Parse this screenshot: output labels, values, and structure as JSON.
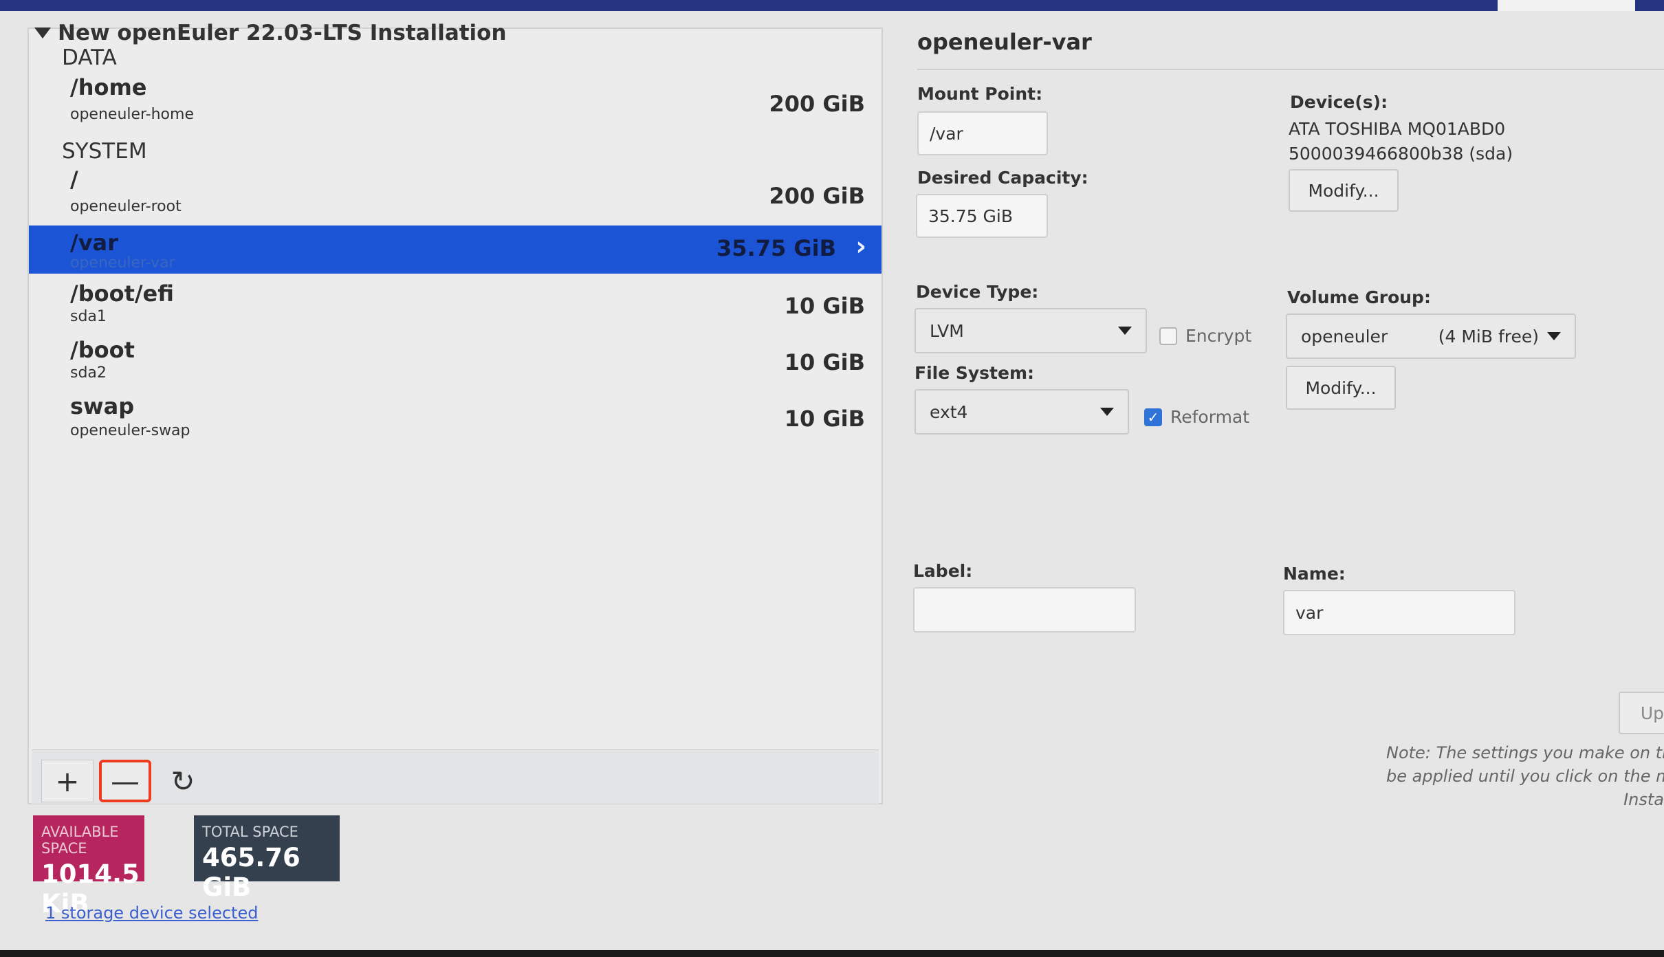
{
  "left": {
    "install_title": "New openEuler 22.03-LTS Installation",
    "sections": [
      {
        "name": "DATA",
        "items": [
          {
            "mount": "/home",
            "device": "openeuler-home",
            "size": "200 GiB"
          }
        ]
      },
      {
        "name": "SYSTEM",
        "items": [
          {
            "mount": "/",
            "device": "openeuler-root",
            "size": "200 GiB"
          },
          {
            "mount": "/var",
            "device": "openeuler-var",
            "size": "35.75 GiB",
            "selected": true
          },
          {
            "mount": "/boot/efi",
            "device": "sda1",
            "size": "10 GiB"
          },
          {
            "mount": "/boot",
            "device": "sda2",
            "size": "10 GiB"
          },
          {
            "mount": "swap",
            "device": "openeuler-swap",
            "size": "10 GiB"
          }
        ]
      }
    ],
    "toolbar": {
      "add_icon": "+",
      "remove_icon": "—",
      "refresh_icon": "↻"
    },
    "available_space": {
      "label": "AVAILABLE SPACE",
      "value": "1014.5 KiB"
    },
    "total_space": {
      "label": "TOTAL SPACE",
      "value": "465.76 GiB"
    },
    "storage_link": "1 storage device selected"
  },
  "right": {
    "title": "openeuler-var",
    "mount_point": {
      "label": "Mount Point:",
      "value": "/var"
    },
    "desired_capacity": {
      "label": "Desired Capacity:",
      "value": "35.75 GiB"
    },
    "devices": {
      "label": "Device(s):",
      "line1": "ATA TOSHIBA MQ01ABD0",
      "line2": "5000039466800b38 (sda)",
      "modify": "Modify..."
    },
    "device_type": {
      "label": "Device Type:",
      "value": "LVM"
    },
    "encrypt": {
      "label": "Encrypt",
      "checked": false
    },
    "file_system": {
      "label": "File System:",
      "value": "ext4"
    },
    "reformat": {
      "label": "Reformat",
      "checked": true
    },
    "volume_group": {
      "label": "Volume Group:",
      "value": "openeuler",
      "free": "(4 MiB free)",
      "modify": "Modify..."
    },
    "label_field": {
      "label": "Label:",
      "value": ""
    },
    "name_field": {
      "label": "Name:",
      "value": "var"
    },
    "update_button": "Up",
    "note": {
      "line1": "Note:  The settings you make on thi",
      "line2": "be applied until you click on the mai",
      "line3": "Insta"
    }
  }
}
